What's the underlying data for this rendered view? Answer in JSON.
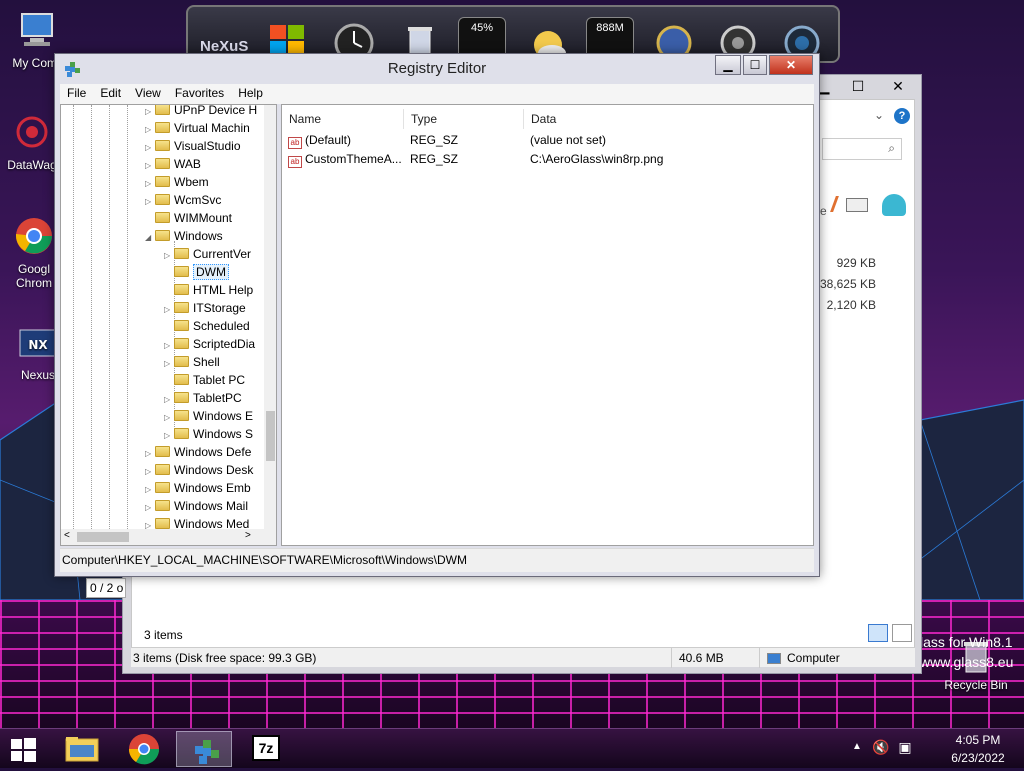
{
  "desktop": {
    "icons": [
      {
        "label": "My Comp",
        "icon": "computer-icon"
      },
      {
        "label": "DataWag",
        "icon": "datawag-icon"
      },
      {
        "label": "Googl Chrom",
        "icon": "chrome-icon"
      },
      {
        "label": "Nexus",
        "icon": "nexus-icon"
      },
      {
        "label": "Recycle Bin",
        "icon": "recycle-bin-icon"
      }
    ],
    "watermark_line1": "lass for Win8.1",
    "watermark_line2": "www.glass8.eu"
  },
  "dock": {
    "label_nexus": "NeXuS",
    "cpu_meter": "45%",
    "memory_meter": "888M"
  },
  "explorer": {
    "sizes": [
      "929 KB",
      "38,625 KB",
      "2,120 KB"
    ],
    "col_fragment": "ze",
    "side_text": "0 / 2 o",
    "items_count": "3 items",
    "status_left": "3 items (Disk free space: 99.3 GB)",
    "status_size": "40.6 MB",
    "status_location": "Computer"
  },
  "regedit": {
    "title": "Registry Editor",
    "menu": [
      "File",
      "Edit",
      "View",
      "Favorites",
      "Help"
    ],
    "tree": [
      {
        "label": "UPnP Device H",
        "level": 1,
        "expander": "collapsed"
      },
      {
        "label": "Virtual Machin",
        "level": 1,
        "expander": "collapsed"
      },
      {
        "label": "VisualStudio",
        "level": 1,
        "expander": "collapsed"
      },
      {
        "label": "WAB",
        "level": 1,
        "expander": "collapsed"
      },
      {
        "label": "Wbem",
        "level": 1,
        "expander": "collapsed"
      },
      {
        "label": "WcmSvc",
        "level": 1,
        "expander": "collapsed"
      },
      {
        "label": "WIMMount",
        "level": 1,
        "expander": "none"
      },
      {
        "label": "Windows",
        "level": 1,
        "expander": "expanded"
      },
      {
        "label": "CurrentVer",
        "level": 2,
        "expander": "collapsed"
      },
      {
        "label": "DWM",
        "level": 2,
        "expander": "none",
        "selected": true
      },
      {
        "label": "HTML Help",
        "level": 2,
        "expander": "none"
      },
      {
        "label": "ITStorage",
        "level": 2,
        "expander": "collapsed"
      },
      {
        "label": "Scheduled",
        "level": 2,
        "expander": "none"
      },
      {
        "label": "ScriptedDia",
        "level": 2,
        "expander": "collapsed"
      },
      {
        "label": "Shell",
        "level": 2,
        "expander": "collapsed"
      },
      {
        "label": "Tablet PC",
        "level": 2,
        "expander": "none"
      },
      {
        "label": "TabletPC",
        "level": 2,
        "expander": "collapsed"
      },
      {
        "label": "Windows E",
        "level": 2,
        "expander": "collapsed"
      },
      {
        "label": "Windows S",
        "level": 2,
        "expander": "collapsed"
      },
      {
        "label": "Windows Defe",
        "level": 1,
        "expander": "collapsed"
      },
      {
        "label": "Windows Desk",
        "level": 1,
        "expander": "collapsed"
      },
      {
        "label": "Windows Emb",
        "level": 1,
        "expander": "collapsed"
      },
      {
        "label": "Windows Mail",
        "level": 1,
        "expander": "collapsed"
      },
      {
        "label": "Windows Med",
        "level": 1,
        "expander": "collapsed"
      }
    ],
    "columns": [
      "Name",
      "Type",
      "Data"
    ],
    "values": [
      {
        "name": "(Default)",
        "type": "REG_SZ",
        "data": "(value not set)"
      },
      {
        "name": "CustomThemeA...",
        "type": "REG_SZ",
        "data": "C:\\AeroGlass\\win8rp.png"
      }
    ],
    "status_path": "Computer\\HKEY_LOCAL_MACHINE\\SOFTWARE\\Microsoft\\Windows\\DWM"
  },
  "taskbar": {
    "items": [
      "start-button",
      "file-explorer",
      "chrome",
      "registry-editor",
      "7zip"
    ],
    "sevenzip_label": "7z",
    "time": "4:05 PM",
    "date": "6/23/2022"
  }
}
